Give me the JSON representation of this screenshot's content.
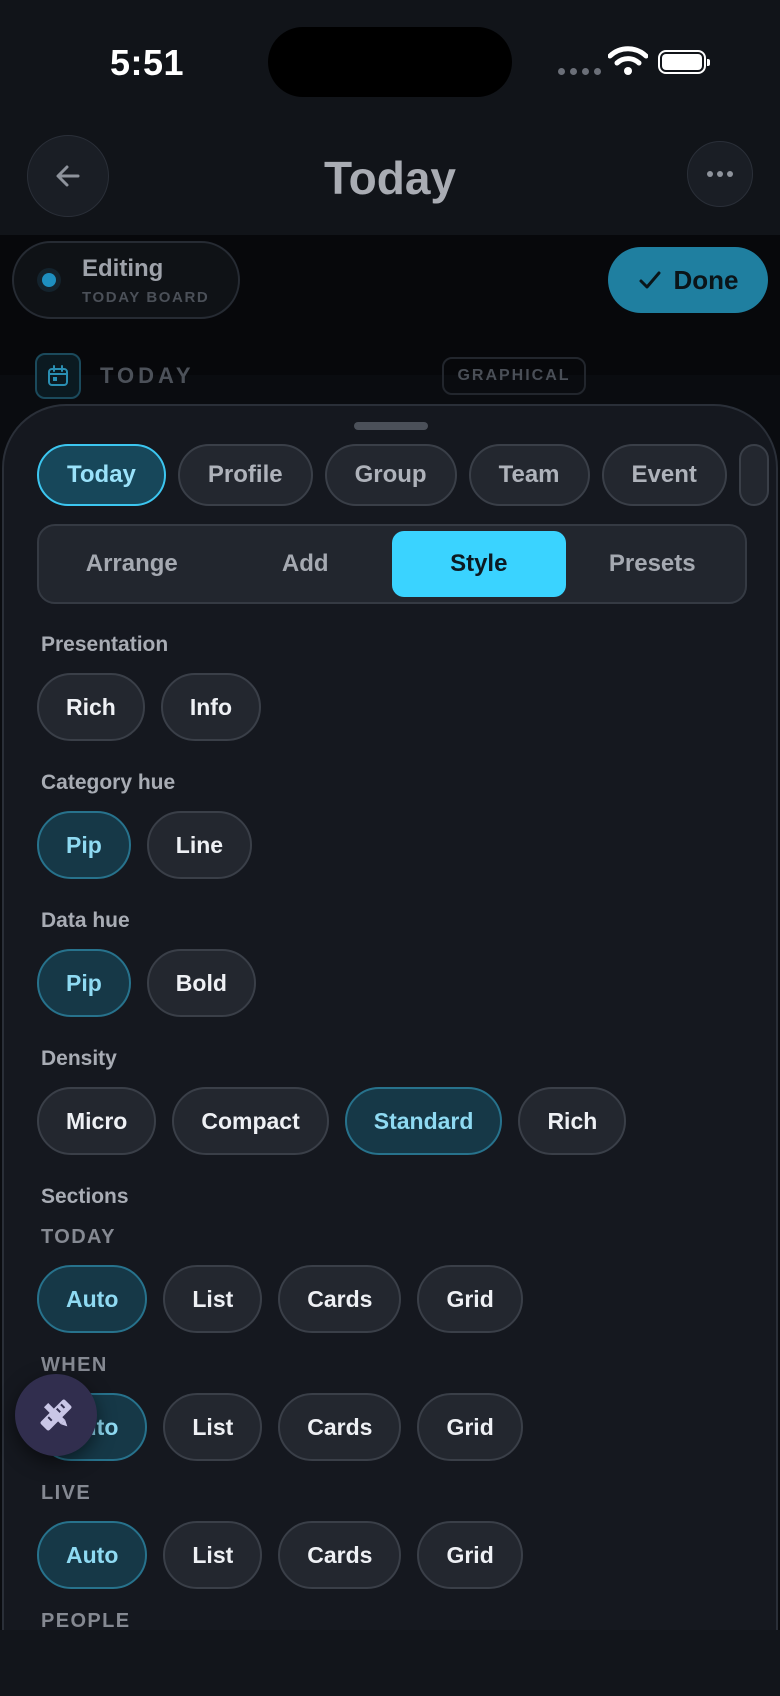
{
  "status": {
    "time": "5:51"
  },
  "header": {
    "title": "Today"
  },
  "edit_bar": {
    "editing_title": "Editing",
    "editing_subtitle": "TODAY BOARD",
    "done_label": "Done",
    "section_heading": "TODAY",
    "badge": "GRAPHICAL"
  },
  "board_tabs": [
    {
      "label": "Today",
      "active": true
    },
    {
      "label": "Profile"
    },
    {
      "label": "Group"
    },
    {
      "label": "Team"
    },
    {
      "label": "Event"
    }
  ],
  "mode_tabs": [
    {
      "label": "Arrange"
    },
    {
      "label": "Add"
    },
    {
      "label": "Style",
      "active": true
    },
    {
      "label": "Presets"
    }
  ],
  "style": {
    "presentation": {
      "label": "Presentation",
      "options": [
        "Rich",
        "Info"
      ],
      "selected": null
    },
    "category_hue": {
      "label": "Category hue",
      "options": [
        "Pip",
        "Line"
      ],
      "selected": "Pip"
    },
    "data_hue": {
      "label": "Data hue",
      "options": [
        "Pip",
        "Bold"
      ],
      "selected": "Pip"
    },
    "density": {
      "label": "Density",
      "options": [
        "Micro",
        "Compact",
        "Standard",
        "Rich"
      ],
      "selected": "Standard"
    },
    "sections": {
      "label": "Sections",
      "groups": [
        {
          "name": "TODAY",
          "options": [
            "Auto",
            "List",
            "Cards",
            "Grid"
          ],
          "selected": "Auto"
        },
        {
          "name": "WHEN",
          "options": [
            "Auto",
            "List",
            "Cards",
            "Grid"
          ],
          "selected": "Auto"
        },
        {
          "name": "LIVE",
          "options": [
            "Auto",
            "List",
            "Cards",
            "Grid"
          ],
          "selected": "Auto"
        },
        {
          "name": "PEOPLE"
        }
      ]
    }
  },
  "icons": {
    "back": "arrow-left-icon",
    "more": "more-horizontal-icon",
    "calendar": "calendar-icon",
    "check": "check-icon",
    "fab": "design-tools-icon"
  },
  "colors": {
    "accent": "#3ad3ff",
    "selected_chip_bg": "#163847",
    "selected_chip_text": "#8fdaf2",
    "done_button": "#1f7fa0",
    "fab_bg": "#312e4e"
  }
}
